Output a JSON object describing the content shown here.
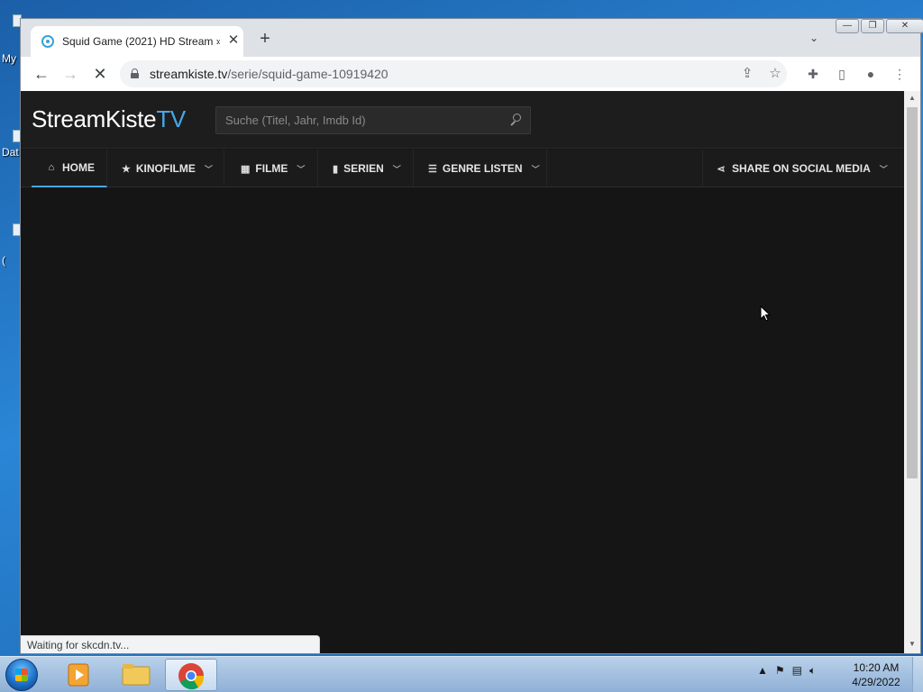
{
  "desktop": {
    "icon_labels": [
      "My",
      "Dat",
      "("
    ]
  },
  "browser": {
    "tab": {
      "title": "Squid Game (2021) HD Stream »",
      "close_glyph": "✕"
    },
    "new_tab_glyph": "+",
    "tab_search_glyph": "⌄",
    "window_buttons": {
      "minimize": "—",
      "restore": "❐",
      "close": "✕"
    },
    "address_bar": {
      "host": "streamkiste.tv",
      "path": "/serie/squid-game-10919420"
    },
    "status_text": "Waiting for skcdn.tv..."
  },
  "site": {
    "logo": {
      "main": "StreamKiste",
      "suffix": "TV"
    },
    "search_placeholder": "Suche (Titel, Jahr, Imdb Id)",
    "nav": [
      {
        "label": "HOME",
        "icon": "home-icon"
      },
      {
        "label": "KINOFILME",
        "icon": "star-icon"
      },
      {
        "label": "FILME",
        "icon": "film-icon"
      },
      {
        "label": "SERIEN",
        "icon": "bookmark-icon"
      },
      {
        "label": "GENRE LISTEN",
        "icon": "list-icon"
      },
      {
        "label": "SHARE ON SOCIAL MEDIA",
        "icon": "share-icon"
      }
    ],
    "accent_color": "#45a8ea"
  },
  "taskbar": {
    "time": "10:20 AM",
    "date": "4/29/2022"
  }
}
